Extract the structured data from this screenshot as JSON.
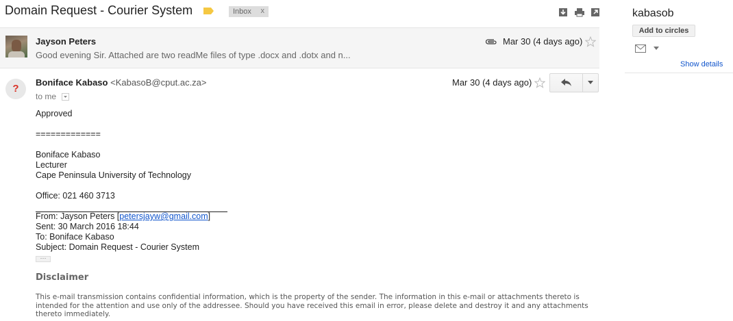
{
  "header": {
    "subject": "Domain Request - Courier System",
    "label": "Inbox",
    "label_close": "x",
    "label_color": "#f5c842",
    "icons": [
      "download-icon",
      "print-icon",
      "new-window-icon"
    ]
  },
  "collapsed_message": {
    "sender": "Jayson Peters",
    "snippet": "Good evening Sir. Attached are two readMe files of type .docx and .dotx and n...",
    "date": "Mar 30 (4 days ago)",
    "has_attachment": true
  },
  "open_message": {
    "sender": "Boniface Kabaso",
    "email": "<KabasoB@cput.ac.za>",
    "to": "to me",
    "date": "Mar 30 (4 days ago)",
    "body": {
      "approved": "Approved",
      "separator": "=============",
      "sig_name": "Boniface Kabaso",
      "sig_title": "Lecturer",
      "sig_org": "Cape Peninsula University of Technology",
      "office": "Office: 021 460 3713",
      "from_prefix": "From: Jayson Peters [",
      "from_email": "petersjayw@gmail.com",
      "from_suffix": "]",
      "sent": "Sent: 30 March 2016 18:44",
      "to": "To: Boniface Kabaso",
      "subject": "Subject: Domain Request - Courier System",
      "ellipsis": "···",
      "disclaimer_title": "Disclaimer",
      "disclaimer_text": "This e-mail transmission contains confidential information, which is the property of the sender. The information in this e-mail or attachments thereto is intended for the attention and use only of the addressee. Should you have received this email in error, please delete and destroy it and any attachments thereto immediately."
    }
  },
  "right_panel": {
    "name": "kabasob",
    "add_to_circles": "Add to circles",
    "show_details": "Show details"
  }
}
